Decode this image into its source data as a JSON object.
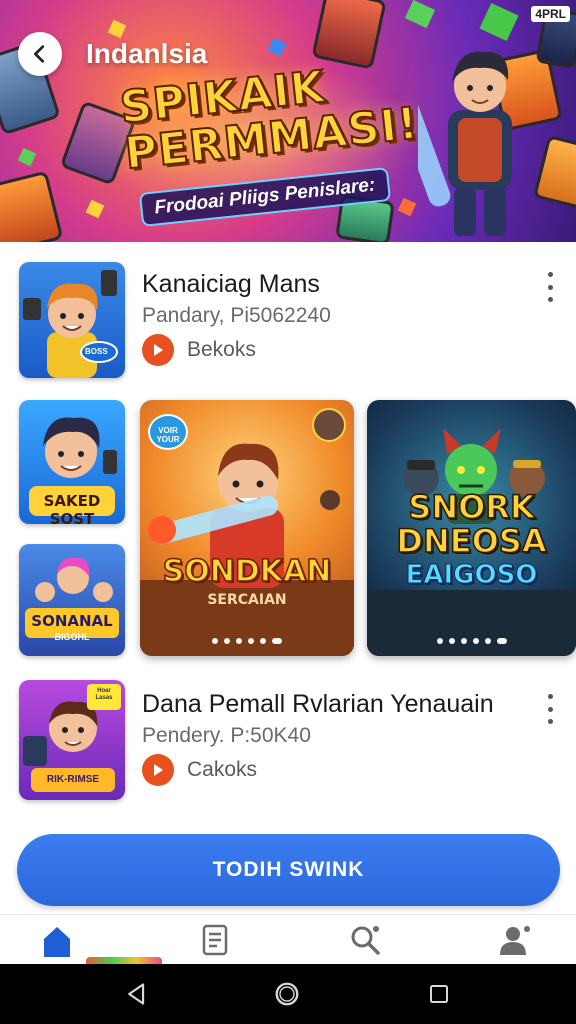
{
  "header": {
    "title": "Indanlsia",
    "corner_badge": "4PRL"
  },
  "banner": {
    "headline_line1": "SPIKAIK",
    "headline_line2": "PERMMASI!",
    "subtitle": "Frodoai Pliigs Penislare:"
  },
  "items": [
    {
      "title": "Kanaiciag Mans",
      "subtitle": "Pandary, Pi5062240",
      "tag": "Bekoks"
    },
    {
      "title": "Dana Pemall Rvlarian Yenauain",
      "subtitle": "Pendery. P:50K40",
      "tag": "Cakoks"
    }
  ],
  "carousel": {
    "small_top_label": "SAKED SOST",
    "small_bottom_label": "SONANAL",
    "small_bottom_sublabel": "BIGOHL",
    "card1_title": "SONDKAN",
    "card1_subtitle": "SERCAIAN",
    "card1_badge": "VOIR YOUR",
    "card2_title_line1": "SNORK",
    "card2_title_line2": "DNEOSA",
    "card2_title_line3": "EAIGOSO"
  },
  "thumb_labels": {
    "item1_badge": "BOSS",
    "item2_banner": "RIK-RIMSE",
    "item2_flag": "Hoar Lasas"
  },
  "cta": {
    "label": "TODIH SWINK"
  },
  "bottom_nav": {
    "items": [
      "home-icon",
      "document-icon",
      "search-icon",
      "profile-icon"
    ]
  },
  "system_nav": [
    "back-triangle-icon",
    "home-circle-icon",
    "recents-square-icon"
  ],
  "colors": {
    "accent": "#2f6fe4",
    "play": "#e8501f",
    "nav_active": "#1f5fd6",
    "nav_inactive": "#6b6b6b"
  }
}
